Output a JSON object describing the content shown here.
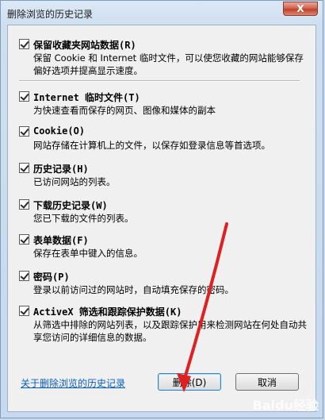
{
  "window": {
    "title": "删除浏览的历史记录",
    "close_label": "X"
  },
  "items": [
    {
      "title": "保留收藏夹网站数据(R)",
      "description": "保留 Cookie 和 Internet 临时文件，可以使您收藏的网站能够保存偏好选项并提高显示速度。",
      "checked": true
    },
    {
      "title": "Internet 临时文件(T)",
      "description": "为快速查看而保存的网页、图像和媒体的副本",
      "checked": true
    },
    {
      "title": "Cookie(O)",
      "description": "网站存储在计算机上的文件，以保存如登录信息等首选项。",
      "checked": true
    },
    {
      "title": "历史记录(H)",
      "description": "已访问网站的列表。",
      "checked": true
    },
    {
      "title": "下载历史记录(W)",
      "description": "您已下载的文件的列表。",
      "checked": true
    },
    {
      "title": "表单数据(F)",
      "description": "保存在表单中键入的信息。",
      "checked": true
    },
    {
      "title": "密码(P)",
      "description": "登录以前访问过的网站时，自动填充保存的密码。",
      "checked": true
    },
    {
      "title": "ActiveX 筛选和跟踪保护数据(K)",
      "description": "从筛选中排除的网站列表，以及跟踪保护用来检测网站在何处自动共享您访问的详细信息的数据。",
      "checked": true
    }
  ],
  "footer": {
    "link_text": "关于删除浏览的历史记录",
    "delete_label": "删除(D)",
    "cancel_label": "取消"
  },
  "watermark": "Baidu经验",
  "colors": {
    "link": "#0b5fbe",
    "arrow": "#e02020",
    "close_button": "#c0402a"
  }
}
